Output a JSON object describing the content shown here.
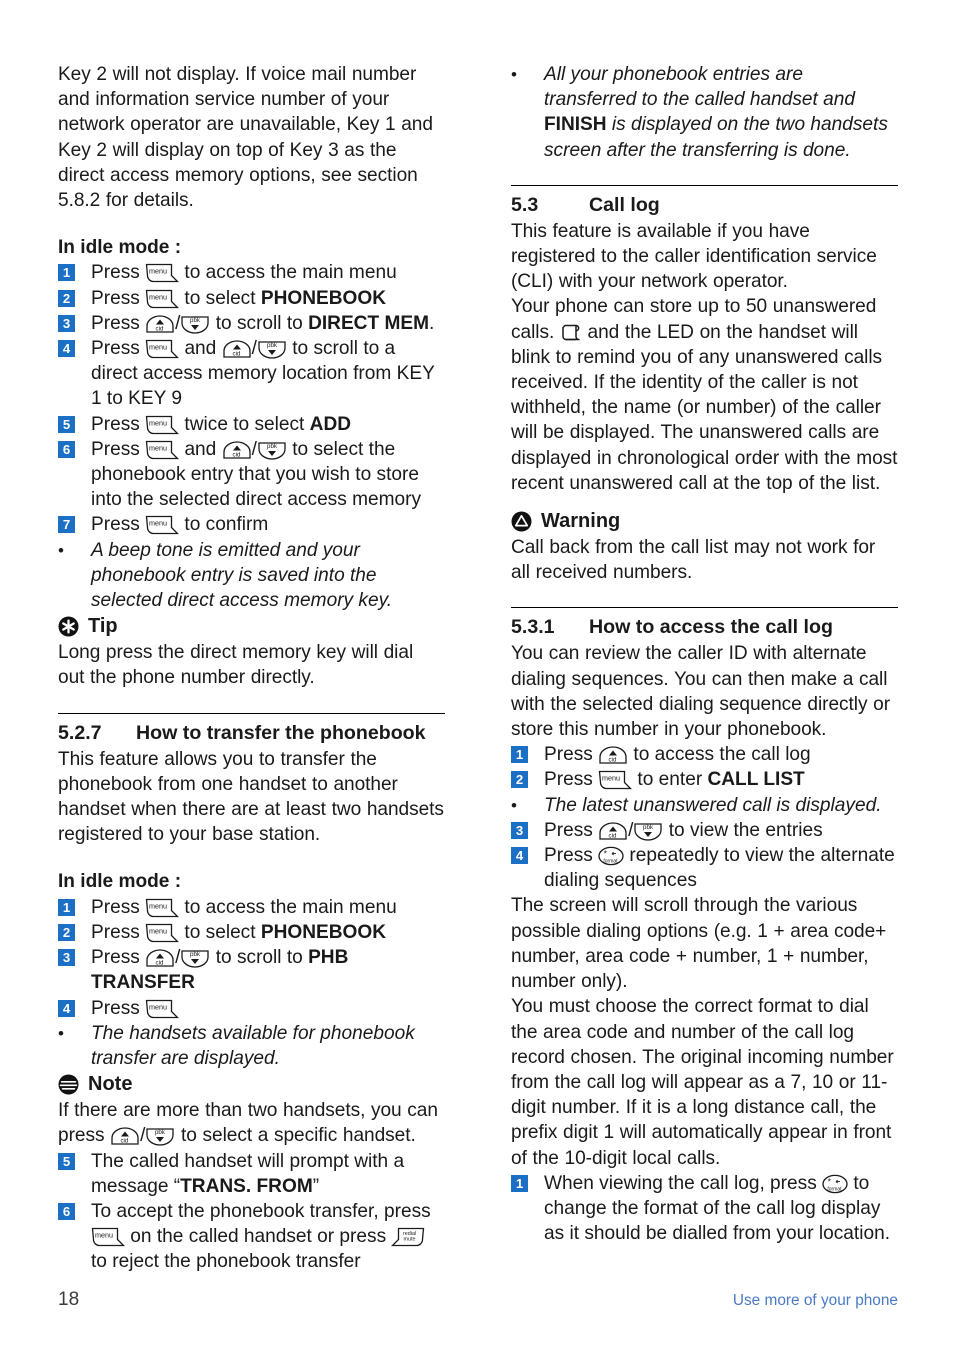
{
  "page": {
    "number": "18",
    "footer_label": "Use more of your phone",
    "accent_blue": "#1b6fc4",
    "footer_blue": "#4a79c7"
  },
  "left_column": {
    "intro_paragraph": "Key 2 will not display. If voice mail number and information service number of your network operator are unavailable, Key 1 and Key 2 will display on top of Key 3 as the direct access memory options, see section 5.8.2 for details.",
    "idle_heading": "In idle mode :",
    "steps": [
      {
        "num": "1",
        "pre": "Press ",
        "icons": [
          "menu"
        ],
        "mid": " to access the main menu",
        "post": "",
        "bold": ""
      },
      {
        "num": "2",
        "pre": "Press ",
        "icons": [
          "menu"
        ],
        "mid": " to select ",
        "bold": "PHONEBOOK",
        "post": ""
      },
      {
        "num": "3",
        "pre": "Press ",
        "icons": [
          "cid",
          "pbk"
        ],
        "mid": " to scroll to ",
        "bold": "DIRECT MEM",
        "post": "."
      },
      {
        "num": "4",
        "pre": "Press ",
        "icons": [
          "menu",
          "cid",
          "pbk"
        ],
        "mid": " to scroll to a direct access memory location from KEY 1 to KEY 9",
        "bold": "",
        "post": ""
      },
      {
        "num": "5",
        "pre": "Press ",
        "icons": [
          "menu"
        ],
        "mid": " twice to select ",
        "bold": "ADD",
        "post": ""
      },
      {
        "num": "6",
        "pre": "Press ",
        "icons": [
          "menu",
          "cid",
          "pbk"
        ],
        "mid": " to select the phonebook entry that you wish to store into the selected direct access memory",
        "bold": "",
        "post": ""
      },
      {
        "num": "7",
        "pre": "Press ",
        "icons": [
          "menu"
        ],
        "mid": " to confirm",
        "bold": "",
        "post": ""
      }
    ],
    "step4_and": "and",
    "step6_and": "and",
    "note_bullet": "A beep tone is emitted and your phonebook entry is saved into the selected direct access memory key.",
    "tip": {
      "label": "Tip",
      "body": "Long press the direct memory key will dial out the phone number directly."
    },
    "section_527": {
      "number": "5.2.7",
      "title": "How to transfer the phonebook",
      "body": "This feature allows you to transfer the phonebook from one handset to another handset when there are at least two handsets registered to your base station."
    },
    "idle_heading_2": "In idle mode :",
    "steps2": [
      {
        "num": "1",
        "pre": "Press ",
        "icons": [
          "menu"
        ],
        "mid": " to access the main menu",
        "bold": "",
        "post": ""
      },
      {
        "num": "2",
        "pre": "Press ",
        "icons": [
          "menu"
        ],
        "mid": " to select ",
        "bold": "PHONEBOOK",
        "post": ""
      },
      {
        "num": "3",
        "pre": "Press ",
        "icons": [
          "cid",
          "pbk"
        ],
        "mid": " to scroll to ",
        "bold": "PHB TRANSFER",
        "post": ""
      },
      {
        "num": "4",
        "pre": "Press ",
        "icons": [
          "menu"
        ],
        "mid": "",
        "bold": "",
        "post": ""
      }
    ],
    "handsets_bullet": "The handsets available for phonebook transfer are displayed.",
    "note": {
      "label": "Note",
      "body_pre": "If there are more than two handsets, you can press ",
      "body_post": " to select a specific handset."
    },
    "steps3": [
      {
        "num": "5",
        "pre": "The called handset will prompt with a message “",
        "bold": "TRANS. FROM",
        "post": "”"
      },
      {
        "num": "6",
        "pre": "To accept the phonebook transfer, press ",
        "mid": " on the called handset or press ",
        "post": " to reject the phonebook transfer"
      }
    ]
  },
  "right_column": {
    "finish_bullet": {
      "pre": "All your phonebook entries are transferred to the called handset and ",
      "bold": "FINISH",
      "post": " is displayed on the two handsets screen after the transferring is done."
    },
    "section_53": {
      "number": "5.3",
      "title": "Call log",
      "para1": "This feature is available if you have registered to the caller identification service (CLI) with your network operator.",
      "para2_pre": "Your phone can store up to 50 unanswered calls. ",
      "para2_post": " and the LED on the handset will blink to remind you of any unanswered calls received. If the identity of the caller is not withheld, the name (or number) of the caller will be displayed. The unanswered calls are displayed in chronological order with the most recent unanswered call at the top of the list."
    },
    "warning": {
      "label": "Warning",
      "body": "Call back from the call list may not work for all received numbers."
    },
    "section_531": {
      "number": "5.3.1",
      "title": "How to access the call log",
      "body": "You can review the caller ID with alternate dialing sequences. You can then make a call with the selected dialing sequence directly or store this number in your phonebook."
    },
    "steps": [
      {
        "num": "1",
        "pre": "Press ",
        "icons": [
          "cid"
        ],
        "mid": " to access the call log",
        "bold": "",
        "post": ""
      },
      {
        "num": "2",
        "pre": "Press ",
        "icons": [
          "menu"
        ],
        "mid": " to enter ",
        "bold": "CALL LIST",
        "post": ""
      },
      {
        "num": "3",
        "pre": "Press ",
        "icons": [
          "cid",
          "pbk"
        ],
        "mid": " to view the entries",
        "bold": "",
        "post": ""
      },
      {
        "num": "4",
        "pre": "Press ",
        "icons": [
          "format"
        ],
        "mid": " repeatedly to view the alternate dialing sequences",
        "bold": "",
        "post": ""
      }
    ],
    "latest_bullet": "The latest unanswered call is displayed.",
    "scroll_para": {
      "p1": "The screen will scroll through the various possible dialing options (e.g. 1 + area code+ number, area code + number, 1 + number, number only).",
      "p2": "You must choose the correct format to dial the area code and number of the call log record chosen. The original incoming number from the call log will appear as a 7, 10 or 11-digit number. If it is a long distance call, the prefix digit 1 will automatically appear in front of the 10-digit local calls."
    },
    "final_step": {
      "num": "1",
      "pre": "When viewing the call log, press ",
      "post": " to change the format of the call log display as it should be dialled from your location."
    }
  },
  "icons": {
    "menu": "menu-softkey-icon",
    "cid": "cid-up-key-icon",
    "pbk": "pbk-down-key-icon",
    "format": "format-star-key-icon",
    "redial": "redial-mute-softkey-icon",
    "scroll": "missed-call-scroll-icon",
    "tip": "tip-asterisk-icon",
    "note": "note-lines-icon",
    "warning": "warning-triangle-icon"
  }
}
